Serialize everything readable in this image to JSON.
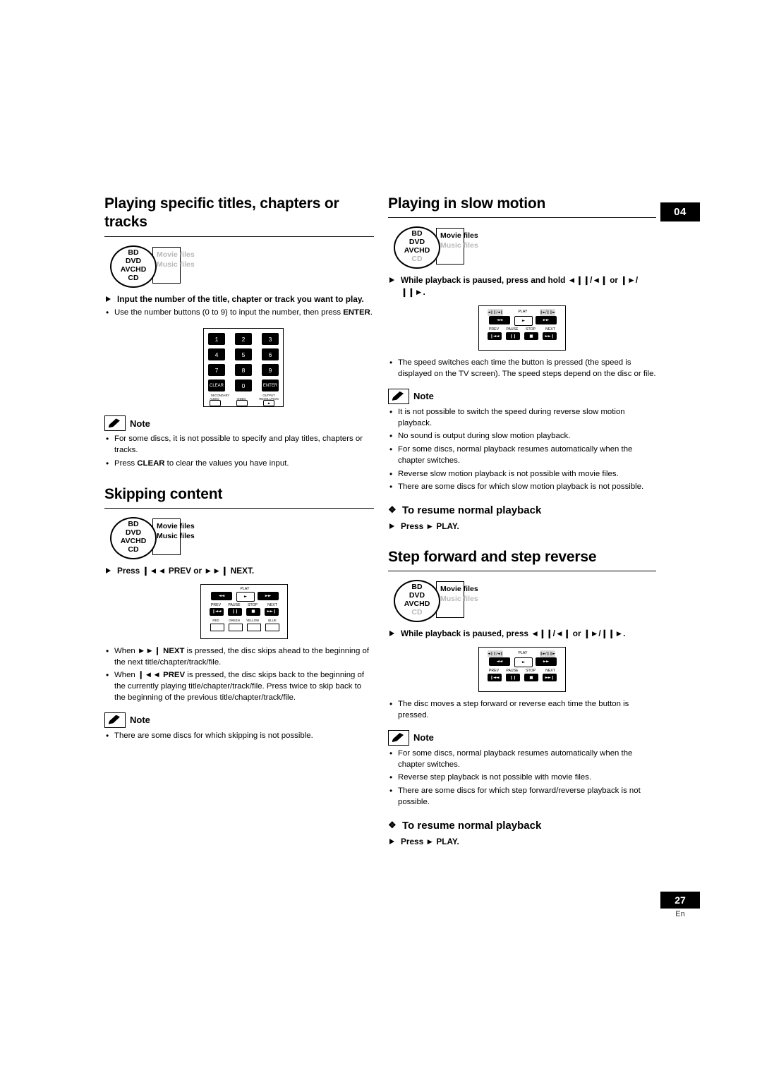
{
  "chapter_tab": "04",
  "page_number": "27",
  "page_lang": "En",
  "left_column": {
    "heading": "Playing specific titles, chapters or tracks",
    "disc_icons": {
      "oval": [
        "BD",
        "DVD",
        "AVCHD",
        "CD"
      ],
      "oval_grey": [],
      "files": [
        "Movie files",
        "Music files"
      ],
      "files_grey": [
        "Movie files",
        "Music files"
      ]
    },
    "step": "Input the number of the title, chapter or track you want to play.",
    "bullets": [
      "Use the number buttons (0 to 9) to input the number, then press ENTER."
    ],
    "keypad": {
      "keys": [
        "1",
        "2",
        "3",
        "4",
        "5",
        "6",
        "7",
        "8",
        "9",
        "CLEAR",
        "0",
        "ENTER"
      ],
      "bottom_labels": [
        "SECONDARY",
        "AUDIO",
        "VIDEO",
        "OUTPUT RESOLUTION"
      ]
    },
    "note": {
      "title": "Note",
      "items": [
        "For some discs, it is not possible to specify and play titles, chapters or tracks.",
        "Press CLEAR to clear the values you have input."
      ]
    },
    "skipping": {
      "heading": "Skipping content",
      "disc_icons": {
        "oval": [
          "BD",
          "DVD",
          "AVCHD",
          "CD"
        ],
        "files": [
          "Movie files",
          "Music files"
        ]
      },
      "step": "Press PREV or NEXT.",
      "step_prev_glyph": "◄◄",
      "step_next_glyph": "►►",
      "remote_labels": {
        "play": "PLAY",
        "prev": "PREV",
        "pause": "PAUSE",
        "stop": "STOP",
        "next": "NEXT",
        "colors": [
          "RED",
          "GREEN",
          "YELLOW",
          "BLUE"
        ]
      },
      "bullets": [
        "When NEXT is pressed, the disc skips ahead to the beginning of the next title/chapter/track/file.",
        "When PREV is pressed, the disc skips back to the beginning of the currently playing title/chapter/track/file. Press twice to skip back to the beginning of the previous title/chapter/track/file."
      ],
      "note": {
        "title": "Note",
        "items": [
          "There are some discs for which skipping is not possible."
        ]
      }
    }
  },
  "right_column": {
    "slow_motion": {
      "heading": "Playing in slow motion",
      "disc_icons": {
        "oval": [
          "BD",
          "DVD",
          "AVCHD",
          "CD"
        ],
        "oval_grey": [
          "CD"
        ],
        "files": [
          "Movie files"
        ],
        "files_grey": [
          "Music files"
        ]
      },
      "step": "While playback is paused, press and hold ◄❙❙/◄❙ or ❙►/❙❙►.",
      "bullets": [
        "The speed switches each time the button is pressed (the speed is displayed on the TV screen). The speed steps depend on the disc or file."
      ],
      "note": {
        "title": "Note",
        "items": [
          "It is not possible to switch the speed during reverse slow motion playback.",
          "No sound is output during slow motion playback.",
          "For some discs, normal playback resumes automatically when the chapter switches.",
          "Reverse slow motion playback is not possible with movie files.",
          "There are some discs for which slow motion playback is not possible."
        ]
      },
      "resume_heading": "To resume normal playback",
      "resume_step": "Press ► PLAY."
    },
    "step_forward": {
      "heading": "Step forward and step reverse",
      "disc_icons": {
        "oval": [
          "BD",
          "DVD",
          "AVCHD",
          "CD"
        ],
        "oval_grey": [
          "CD"
        ],
        "files": [
          "Movie files"
        ],
        "files_grey": [
          "Music files"
        ]
      },
      "step": "While playback is paused, press ◄❙❙/◄❙ or ❙►/❙❙►.",
      "bullets": [
        "The disc moves a step forward or reverse each time the button is pressed."
      ],
      "note": {
        "title": "Note",
        "items": [
          "For some discs, normal playback resumes automatically when the chapter switches.",
          "Reverse step playback is not possible with movie files.",
          "There are some discs for which step forward/reverse playback is not possible."
        ]
      },
      "resume_heading": "To resume normal playback",
      "resume_step": "Press ► PLAY."
    },
    "remote_labels": {
      "play": "PLAY",
      "prev": "PREV",
      "pause": "PAUSE",
      "stop": "STOP",
      "next": "NEXT",
      "slow_left": "◄❙❙/◄❙",
      "slow_right": "❙►/❙❙►"
    }
  }
}
